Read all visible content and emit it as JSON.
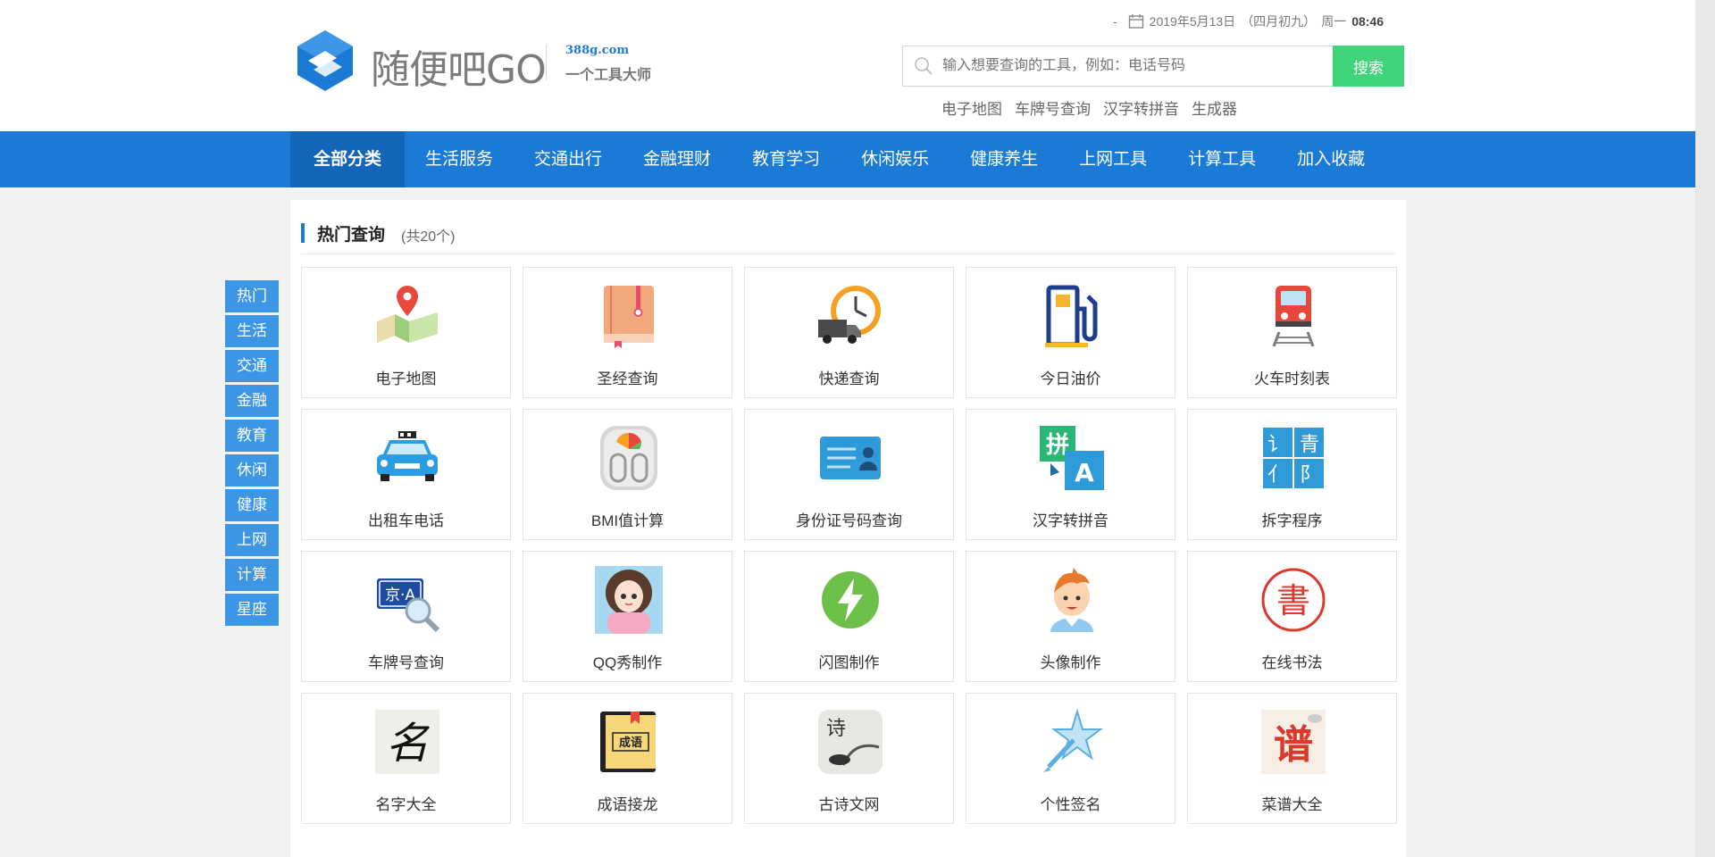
{
  "header": {
    "logo_name": "随便吧GO",
    "logo_domain": "388g.com",
    "logo_slogan": "一个工具大师",
    "date_prefix": "-",
    "date": "2019年5月13日",
    "lunar": "（四月初九）",
    "weekday": "周一",
    "time": "08:46"
  },
  "search": {
    "placeholder": "输入想要查询的工具，例如：电话号码",
    "button_label": "搜索",
    "hot_links": [
      "电子地图",
      "车牌号查询",
      "汉字转拼音",
      "生成器"
    ]
  },
  "nav": {
    "items": [
      "全部分类",
      "生活服务",
      "交通出行",
      "金融理财",
      "教育学习",
      "休闲娱乐",
      "健康养生",
      "上网工具",
      "计算工具",
      "加入收藏"
    ],
    "active_index": 0
  },
  "section": {
    "title": "热门查询",
    "count": "(共20个)"
  },
  "tools": [
    {
      "label": "电子地图",
      "icon": "map-icon"
    },
    {
      "label": "圣经查询",
      "icon": "bible-book-icon"
    },
    {
      "label": "快递查询",
      "icon": "delivery-truck-clock-icon"
    },
    {
      "label": "今日油价",
      "icon": "fuel-pump-icon"
    },
    {
      "label": "火车时刻表",
      "icon": "train-icon"
    },
    {
      "label": "出租车电话",
      "icon": "taxi-icon"
    },
    {
      "label": "BMI值计算",
      "icon": "bmi-scale-icon"
    },
    {
      "label": "身份证号码查询",
      "icon": "id-card-icon"
    },
    {
      "label": "汉字转拼音",
      "icon": "pinyin-convert-icon"
    },
    {
      "label": "拆字程序",
      "icon": "split-character-icon"
    },
    {
      "label": "车牌号查询",
      "icon": "license-plate-search-icon"
    },
    {
      "label": "QQ秀制作",
      "icon": "qq-show-avatar-icon"
    },
    {
      "label": "闪图制作",
      "icon": "lightning-icon"
    },
    {
      "label": "头像制作",
      "icon": "boy-avatar-icon"
    },
    {
      "label": "在线书法",
      "icon": "calligraphy-seal-icon"
    },
    {
      "label": "名字大全",
      "icon": "name-calligraphy-icon"
    },
    {
      "label": "成语接龙",
      "icon": "idiom-book-icon"
    },
    {
      "label": "古诗文网",
      "icon": "ancient-poetry-icon"
    },
    {
      "label": "个性签名",
      "icon": "signature-star-pen-icon"
    },
    {
      "label": "菜谱大全",
      "icon": "recipe-icon"
    }
  ],
  "icon_text": {
    "pinyin_char": "拼",
    "pinyin_letter": "A",
    "split_chars": [
      "讠",
      "青",
      "亻",
      "阝"
    ],
    "plate_text": "京·A",
    "calligraphy_char": "書",
    "name_char": "名",
    "idiom_text": "成语",
    "poem_char": "诗",
    "recipe_char": "谱"
  },
  "side_nav": [
    "热门",
    "生活",
    "交通",
    "金融",
    "教育",
    "休闲",
    "健康",
    "上网",
    "计算",
    "星座"
  ],
  "colors": {
    "brand_blue": "#1b7ad6",
    "nav_active": "#1265b8",
    "search_green": "#3fd37a",
    "side_blue": "#3d95e6"
  }
}
